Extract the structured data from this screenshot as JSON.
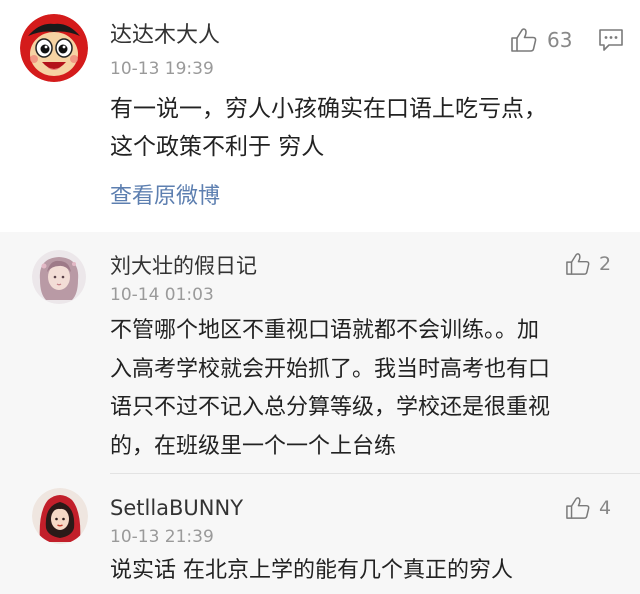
{
  "main_comment": {
    "username": "达达木大人",
    "time": "10-13 19:39",
    "likes": "63",
    "text_lines": [
      "有一说一，穷人小孩确实在口语上吃亏点，",
      "这个政策不利于 穷人"
    ],
    "view_original": "查看原微博"
  },
  "replies": [
    {
      "username": "刘大壮的假日记",
      "time": "10-14 01:03",
      "likes": "2",
      "text_lines": [
        "不管哪个地区不重视口语就都不会训练。。加",
        "入高考学校就会开始抓了。我当时高考也有口",
        "语只不过不记入总分算等级，学校还是很重视",
        "的，在班级里一个一个上台练"
      ]
    },
    {
      "username": "SetllaBUNNY",
      "time": "10-13 21:39",
      "likes": "4",
      "text_lines": [
        "说实话 在北京上学的能有几个真正的穷人"
      ]
    }
  ],
  "colors": {
    "username": "#333333",
    "time": "#9a9a9a",
    "link": "#5d7fb0",
    "reply_background": "#f7f7f7"
  }
}
